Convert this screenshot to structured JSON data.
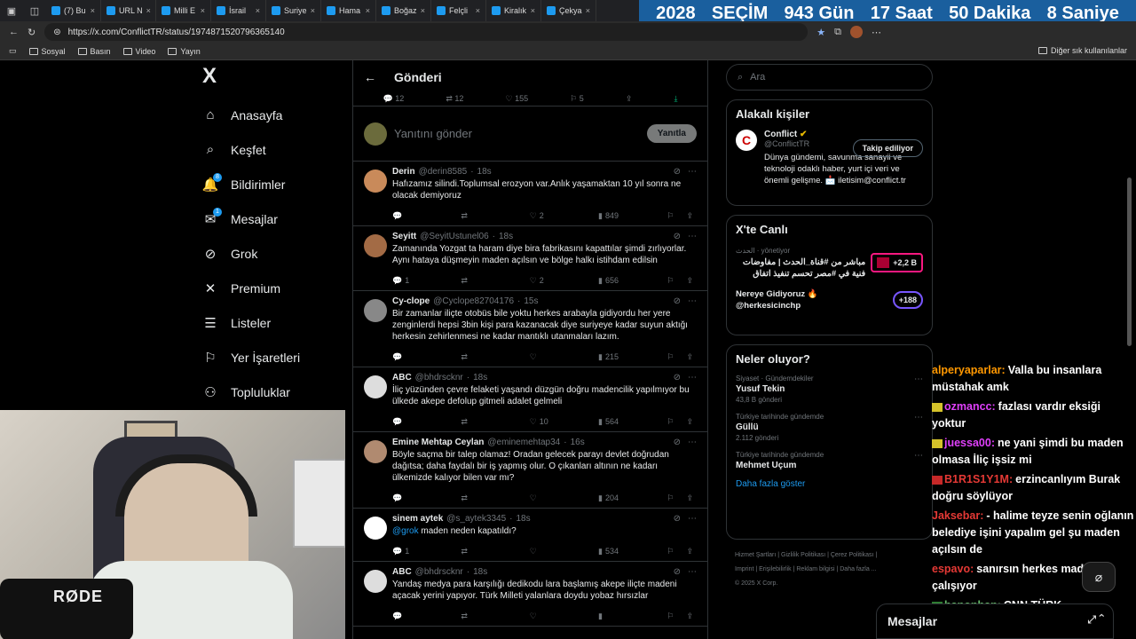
{
  "browser": {
    "tabs": [
      {
        "label": "(7) Bu"
      },
      {
        "label": "URL N"
      },
      {
        "label": "Milli E"
      },
      {
        "label": "İsrail"
      },
      {
        "label": "Suriye"
      },
      {
        "label": "Hama"
      },
      {
        "label": "Boğaz"
      },
      {
        "label": "Felçli"
      },
      {
        "label": "Kiralık"
      },
      {
        "label": "Çekya"
      }
    ],
    "url": "https://x.com/ConflictTR/status/1974871520796365140",
    "bookmarks": [
      "Sosyal",
      "Basın",
      "Video",
      "Yayın"
    ],
    "other_bookmarks": "Diğer sık kullanılanlar"
  },
  "countdown": {
    "year": "2028",
    "label": "SEÇİM",
    "days": "943 Gün",
    "hours": "17 Saat",
    "minutes": "50 Dakika",
    "seconds": "8 Saniye"
  },
  "nav": {
    "logo": "X",
    "items": [
      {
        "label": "Anasayfa",
        "icon": "home-icon"
      },
      {
        "label": "Keşfet",
        "icon": "search-icon"
      },
      {
        "label": "Bildirimler",
        "icon": "bell-icon",
        "badge": "8"
      },
      {
        "label": "Mesajlar",
        "icon": "mail-icon",
        "badge": "1"
      },
      {
        "label": "Grok",
        "icon": "grok-icon"
      },
      {
        "label": "Premium",
        "icon": "x-icon"
      },
      {
        "label": "Listeler",
        "icon": "list-icon"
      },
      {
        "label": "Yer İşaretleri",
        "icon": "bookmark-icon"
      },
      {
        "label": "Topluluklar",
        "icon": "people-icon"
      }
    ]
  },
  "main": {
    "title": "Gönderi",
    "top_actions": {
      "replies": "12",
      "reposts": "12",
      "likes": "155",
      "bookmarks": "5"
    },
    "compose_placeholder": "Yanıtını gönder",
    "reply_button": "Yanıtla",
    "posts": [
      {
        "name": "Derin",
        "handle": "@derin8585",
        "time": "18s",
        "text": "Hafızamız silindi.Toplumsal erozyon var.Anlık yaşamaktan 10 yıl sonra ne olacak demiyoruz",
        "replies": "",
        "likes": "2",
        "views": "849"
      },
      {
        "name": "Seyitt",
        "handle": "@SeyitUstunel06",
        "time": "18s",
        "text": "Zamanında Yozgat ta haram diye bira fabrikasını kapattılar şimdi zırlıyorlar. Aynı hataya düşmeyin maden açılsın ve bölge halkı istihdam edilsin",
        "replies": "1",
        "likes": "2",
        "views": "656"
      },
      {
        "name": "Cy-clope",
        "handle": "@Cyclope82704176",
        "time": "15s",
        "text": "Bir zamanlar iliçte otobüs bile yoktu herkes arabayla gidiyordu her yere zenginlerdi hepsi 3bin kişi para kazanacak diye suriyeye kadar suyun aktığı herkesin zehirlenmesi ne kadar mantıklı utanmaları lazım.",
        "replies": "",
        "likes": "",
        "views": "215"
      },
      {
        "name": "ABC",
        "handle": "@bhdrscknr",
        "time": "18s",
        "text": "İliç yüzünden çevre felaketi yaşandı düzgün doğru madencilik yapılmıyor bu ülkede akepe defolup gitmeli adalet gelmeli",
        "replies": "",
        "likes": "10",
        "views": "564"
      },
      {
        "name": "Emine Mehtap Ceylan",
        "handle": "@eminemehtap34",
        "time": "16s",
        "text": "Böyle saçma bir talep olamaz! Oradan gelecek parayı devlet doğrudan dağıtsa; daha faydalı bir iş yapmış olur.  O çıkanları altının ne kadarı ülkemizde kalıyor bilen var mı?",
        "replies": "",
        "likes": "",
        "views": "204"
      },
      {
        "name": "sinem aytek",
        "handle": "@s_aytek3345",
        "time": "18s",
        "mention": "@grok",
        "text": "maden neden kapatıldı?",
        "replies": "1",
        "likes": "",
        "views": "534"
      },
      {
        "name": "ABC",
        "handle": "@bhdrscknr",
        "time": "18s",
        "text": "Yandaş medya para karşılığı dedikodu lara başlamış akepe iliçte madeni açacak yerini yapıyor. Türk Milleti yalanlara doydu yobaz hırsızlar",
        "replies": "",
        "likes": "",
        "views": ""
      }
    ]
  },
  "right": {
    "search_placeholder": "Ara",
    "related": {
      "title": "Alakalı kişiler",
      "logo": "C",
      "name": "Conflict",
      "handle": "@ConflictTR",
      "follow": "Takip ediliyor",
      "bio": "Dünya gündemi, savunma sanayii ve teknoloji odaklı haber, yurt içi veri ve önemli gelişme. 📩 iletisim@conflict.tr"
    },
    "live": {
      "title": "X'te Canlı",
      "item1_host": "الحدث",
      "item1_role": "yönetiyor",
      "item1_text": "مباشر من #قناة_الحدث | مفاوضات فنية في #مصر تحسم تنفيذ اتفاق",
      "item1_count": "+2,2 B",
      "item2_title": "Nereye Gidiyoruz 🔥",
      "item2_handle": "@herkesicinchp",
      "item2_count": "+188"
    },
    "trends": {
      "title": "Neler oluyor?",
      "items": [
        {
          "category": "Siyaset · Gündemdekiler",
          "name": "Yusuf Tekin",
          "count": "43,8 B gönderi"
        },
        {
          "category": "Türkiye tarihinde gündemde",
          "name": "Güllü",
          "count": "2.112 gönderi"
        },
        {
          "category": "Türkiye tarihinde gündemde",
          "name": "Mehmet Uçum",
          "count": ""
        }
      ],
      "show_more": "Daha fazla göster"
    },
    "footer": {
      "line1": "Hizmet Şartları  |  Gizlilik Politikası  |  Çerez Politikası  |",
      "line2": "Imprint  |  Erişilebilirlik  |  Reklam bilgisi  |  Daha fazla ...",
      "line3": "© 2025 X Corp."
    }
  },
  "chat": [
    {
      "user": "alperyaparlar:",
      "color": "#ff9800",
      "text": "Valla bu insanlara müstahak amk",
      "badge": ""
    },
    {
      "user": "ozmancc:",
      "color": "#e040fb",
      "text": "fazlası vardır eksiği yoktur",
      "badge": "#d4c22a"
    },
    {
      "user": "juessa00:",
      "color": "#e040fb",
      "text": "ne yani şimdi bu maden olmasa İliç işsiz mi",
      "badge": "#d4c22a"
    },
    {
      "user": "B1R1S1Y1M:",
      "color": "#e53935",
      "text": "erzincanlıyım Burak doğru söylüyor",
      "badge": "#c62828"
    },
    {
      "user": "Jaksebar:",
      "color": "#e53935",
      "text": "- halime teyze senin oğlanın belediye işini yapalım gel şu maden açılsın de",
      "badge": ""
    },
    {
      "user": "espavo:",
      "color": "#e53935",
      "text": "sanırsın herkes madende çalışıyor",
      "badge": ""
    },
    {
      "user": "hanonhan:",
      "color": "#66bb6a",
      "text": "CNN TÜRK",
      "badge": "#2e7d32"
    }
  ],
  "cam": {
    "mic_brand": "RØDE"
  },
  "messages_bar": {
    "label": "Mesajlar"
  }
}
